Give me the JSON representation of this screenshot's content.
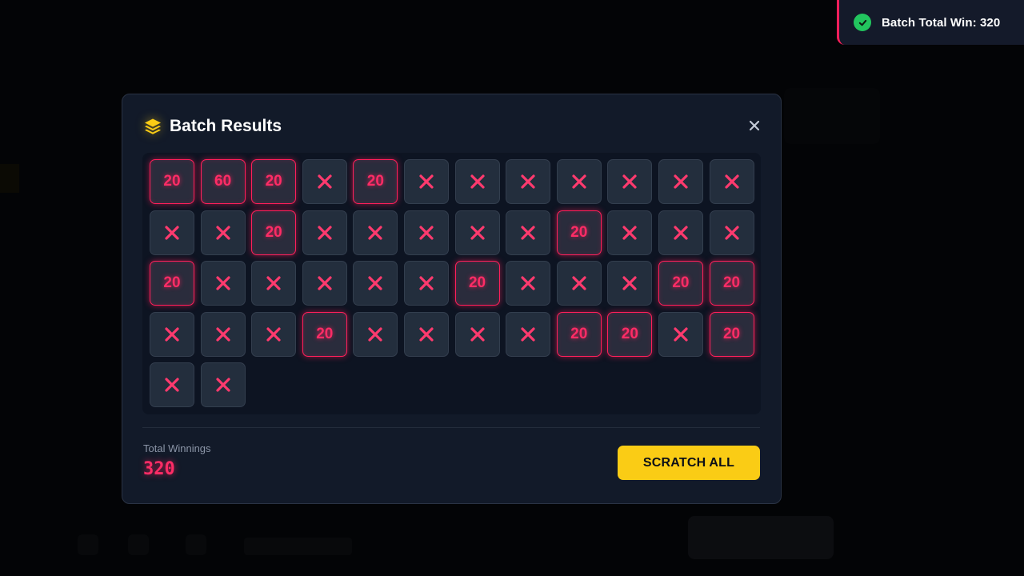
{
  "toast": {
    "text": "Batch Total Win: 320",
    "icon": "check-circle-icon",
    "accent_color": "#ff1f5a",
    "icon_color": "#22c55e"
  },
  "modal": {
    "title": "Batch Results",
    "title_icon": "layers-icon",
    "close_icon": "close-icon",
    "cells": [
      "20",
      "60",
      "20",
      "X",
      "20",
      "X",
      "X",
      "X",
      "X",
      "X",
      "X",
      "X",
      "X",
      "X",
      "20",
      "X",
      "X",
      "X",
      "X",
      "X",
      "20",
      "X",
      "X",
      "X",
      "20",
      "X",
      "X",
      "X",
      "X",
      "X",
      "20",
      "X",
      "X",
      "X",
      "20",
      "20",
      "X",
      "X",
      "X",
      "20",
      "X",
      "X",
      "X",
      "X",
      "20",
      "20",
      "X",
      "20",
      "X",
      "X"
    ],
    "total_label": "Total Winnings",
    "total_value": "320",
    "scratch_button": "SCRATCH ALL"
  },
  "colors": {
    "win": "#ff2c66",
    "accent_yellow": "#facc15",
    "modal_bg": "#121a29"
  }
}
